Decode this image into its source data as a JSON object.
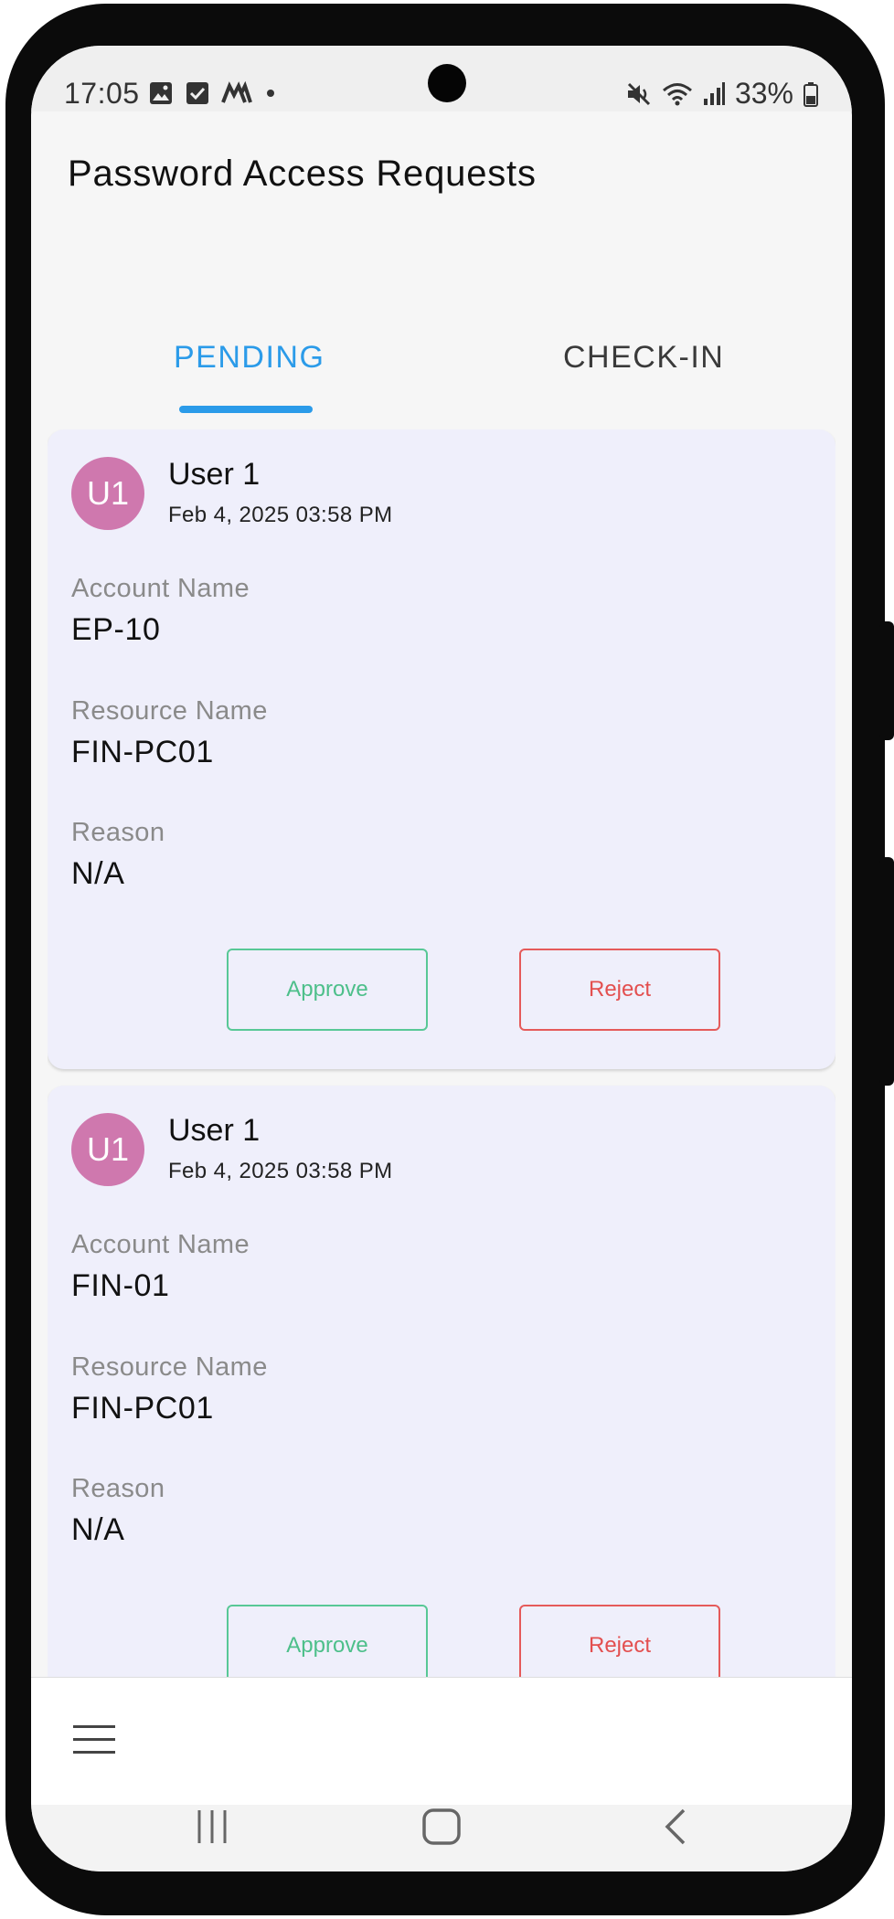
{
  "status_bar": {
    "time": "17:05",
    "battery": "33%",
    "left_icons": [
      "image-icon",
      "check-box-icon",
      "app-logo-icon",
      "dot-icon"
    ],
    "right_icons": [
      "mute-icon",
      "wifi-icon",
      "signal-icon",
      "battery-icon"
    ]
  },
  "header": {
    "title": "Password Access Requests"
  },
  "tabs": [
    {
      "label": "PENDING",
      "active": true
    },
    {
      "label": "CHECK-IN",
      "active": false
    }
  ],
  "colors": {
    "accent": "#2b9be9",
    "avatar": "#cf78ae",
    "approve": "#4dbf8a",
    "reject": "#e34f4f",
    "card_bg": "#efeffb"
  },
  "requests": [
    {
      "avatar_initials": "U1",
      "user_name": "User 1",
      "date": "Feb 4, 2025 03:58 PM",
      "account_label": "Account Name",
      "account_value": "EP-10",
      "resource_label": "Resource Name",
      "resource_value": "FIN-PC01",
      "reason_label": "Reason",
      "reason_value": "N/A",
      "approve_label": "Approve",
      "reject_label": "Reject"
    },
    {
      "avatar_initials": "U1",
      "user_name": "User 1",
      "date": "Feb 4, 2025 03:58 PM",
      "account_label": "Account Name",
      "account_value": "FIN-01",
      "resource_label": "Resource Name",
      "resource_value": "FIN-PC01",
      "reason_label": "Reason",
      "reason_value": "N/A",
      "approve_label": "Approve",
      "reject_label": "Reject"
    }
  ],
  "bottom_bar": {
    "menu_icon": "hamburger-menu-icon"
  },
  "system_nav": {
    "icons": [
      "recent-apps-icon",
      "home-icon",
      "back-icon"
    ]
  }
}
